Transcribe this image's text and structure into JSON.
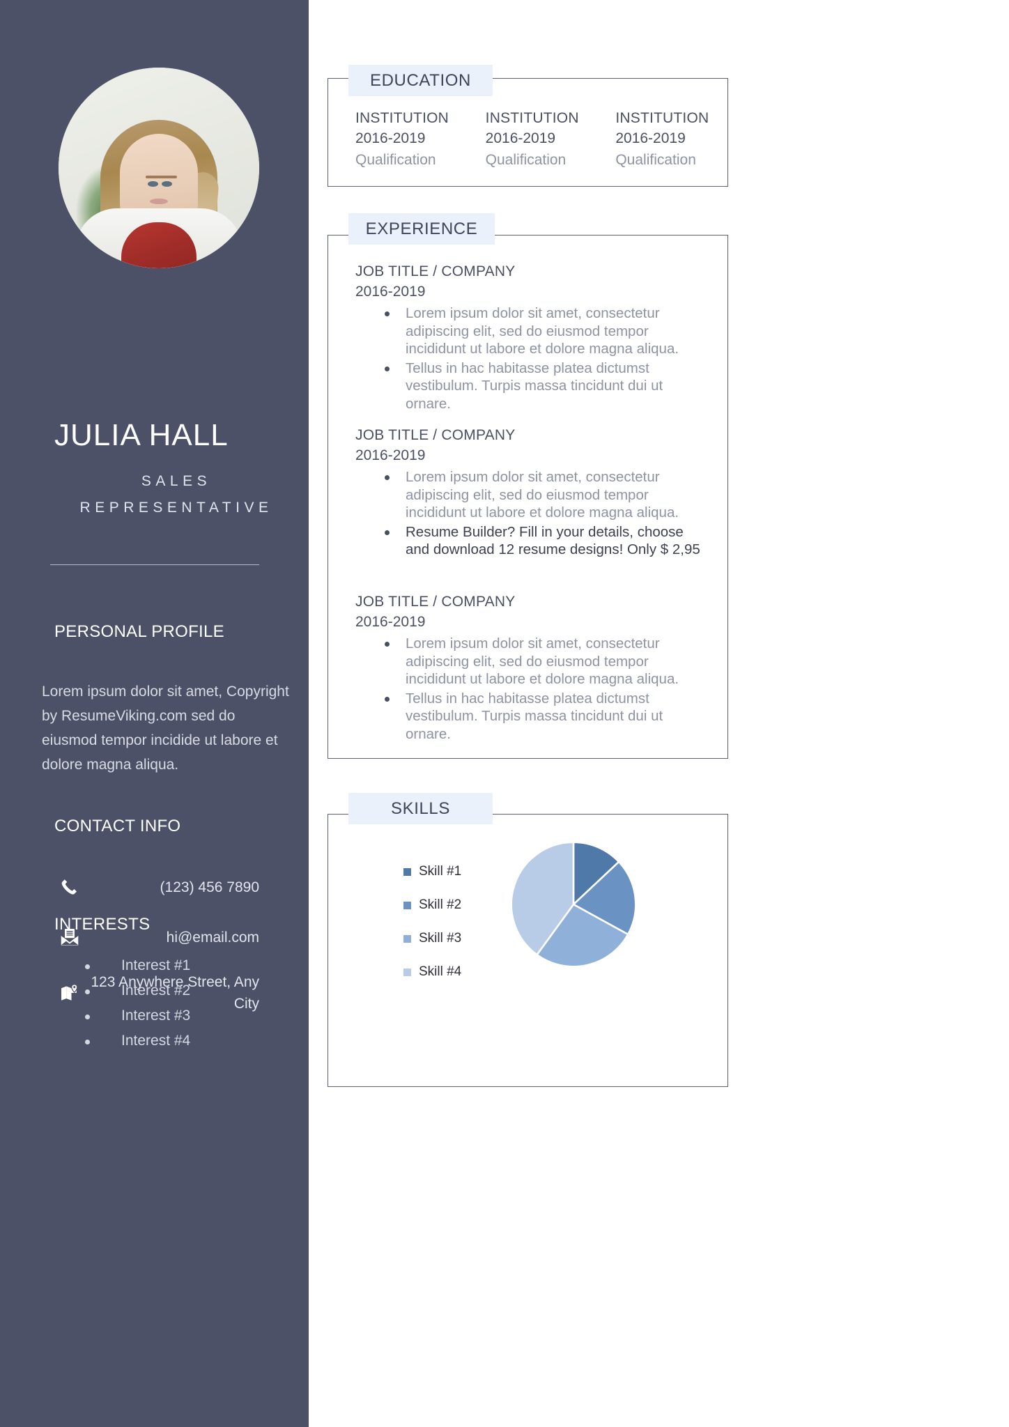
{
  "sidebar": {
    "avatar_alt": "profile-photo",
    "name": "JULIA HALL",
    "subtitle": "SALES REPRESENTATIVE",
    "profile": {
      "heading": "PERSONAL PROFILE",
      "text": "Lorem ipsum dolor sit amet, Copyright by ResumeViking.com sed do eiusmod tempor incidide ut labore et dolore magna aliqua."
    },
    "contact": {
      "heading": "CONTACT INFO",
      "items": [
        {
          "icon": "phone-icon",
          "value": "(123) 456 7890"
        },
        {
          "icon": "email-icon",
          "value": "hi@email.com"
        },
        {
          "icon": "map-icon",
          "value": "123 Anywhere Street, Any City"
        }
      ]
    },
    "interests": {
      "heading": "INTERESTS",
      "items": [
        "Interest #1",
        "Interest #2",
        "Interest #3",
        "Interest #4"
      ]
    },
    "bg_color": "#4c5168"
  },
  "main": {
    "education": {
      "title": "EDUCATION",
      "columns": [
        {
          "institution": "INSTITUTION",
          "years": "2016-2019",
          "qualification": "Qualification"
        },
        {
          "institution": "INSTITUTION",
          "years": "2016-2019",
          "qualification": "Qualification"
        },
        {
          "institution": "INSTITUTION",
          "years": "2016-2019",
          "qualification": "Qualification"
        }
      ]
    },
    "experience": {
      "title": "EXPERIENCE",
      "jobs": [
        {
          "title": "JOB TITLE / COMPANY",
          "years": "2016-2019",
          "bullets": [
            {
              "text": "Lorem ipsum dolor sit amet, consectetur adipiscing elit, sed do eiusmod tempor incididunt ut labore et dolore magna aliqua.",
              "highlight": false
            },
            {
              "text": "Tellus in hac habitasse platea dictumst vestibulum. Turpis massa tincidunt dui ut ornare.",
              "highlight": false
            }
          ]
        },
        {
          "title": "JOB TITLE / COMPANY",
          "years": "2016-2019",
          "bullets": [
            {
              "text": "Lorem ipsum dolor sit amet, consectetur adipiscing elit, sed do eiusmod tempor incididunt ut labore et dolore magna aliqua.",
              "highlight": false
            },
            {
              "text": "Resume Builder? Fill in your details, choose and download 12 resume designs! Only $ 2,95",
              "highlight": true
            }
          ]
        },
        {
          "title": "JOB TITLE / COMPANY",
          "years": "2016-2019",
          "bullets": [
            {
              "text": "Lorem ipsum dolor sit amet, consectetur adipiscing elit, sed do eiusmod tempor incididunt ut labore et dolore magna aliqua.",
              "highlight": false
            },
            {
              "text": "Tellus in hac habitasse platea dictumst vestibulum. Turpis massa tincidunt dui ut ornare.",
              "highlight": false
            }
          ]
        }
      ]
    },
    "skills": {
      "title": "SKILLS"
    }
  },
  "chart_data": {
    "type": "pie",
    "title": "SKILLS",
    "categories": [
      "Skill #1",
      "Skill #2",
      "Skill #3",
      "Skill #4"
    ],
    "values": [
      13,
      20,
      27,
      40
    ],
    "colors": [
      "#4e79a8",
      "#6a93c4",
      "#8fb0d9",
      "#b9cce7"
    ],
    "legend_position": "left",
    "start_angle_deg": 0,
    "explode": false,
    "labels_shown": false
  },
  "theme": {
    "sidebar_bg": "#4c5168",
    "panel_border": "#5b6078",
    "panel_title_bg": "#eaf1fb",
    "heading_text": "#4a4f63",
    "body_text": "#8e93a3",
    "page_bg": "#ffffff"
  }
}
